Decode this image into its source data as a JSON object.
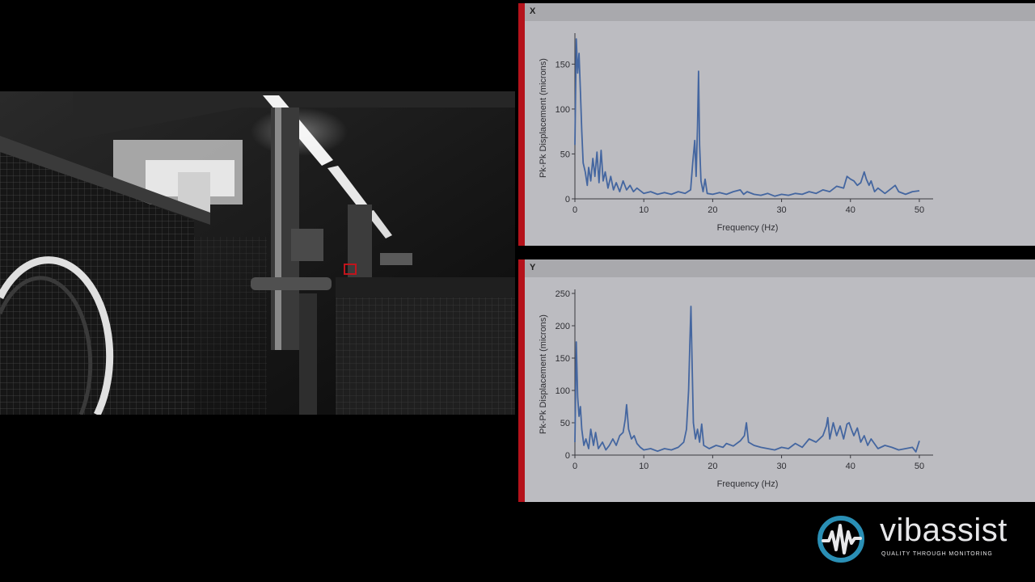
{
  "video": {
    "alt_icon": "factory-camera-feed"
  },
  "brand": {
    "name": "vibassist",
    "tagline": "QUALITY THROUGH MONITORING",
    "accent": "#2a8fb5"
  },
  "colors": {
    "series": "#4466a0",
    "panel_bg": "#bcbcc1",
    "header_bg": "#a9a9ad",
    "red_bar": "#b5121b"
  },
  "chart_data": [
    {
      "type": "line",
      "panel_title": "X",
      "xlabel": "Frequency (Hz)",
      "ylabel": "Pk-Pk Displacement (microns)",
      "xlim": [
        0,
        52
      ],
      "ylim": [
        0,
        180
      ],
      "xticks": [
        0,
        10,
        20,
        30,
        40,
        50
      ],
      "yticks": [
        0,
        50,
        100,
        150
      ],
      "grid": false,
      "series": [
        {
          "values": [
            [
              0,
              60
            ],
            [
              0.2,
              178
            ],
            [
              0.4,
              140
            ],
            [
              0.6,
              162
            ],
            [
              0.8,
              120
            ],
            [
              1.0,
              75
            ],
            [
              1.2,
              40
            ],
            [
              1.5,
              30
            ],
            [
              1.8,
              15
            ],
            [
              2.0,
              35
            ],
            [
              2.3,
              20
            ],
            [
              2.6,
              45
            ],
            [
              2.9,
              25
            ],
            [
              3.2,
              52
            ],
            [
              3.5,
              18
            ],
            [
              3.8,
              54
            ],
            [
              4.1,
              20
            ],
            [
              4.4,
              30
            ],
            [
              4.8,
              12
            ],
            [
              5.2,
              25
            ],
            [
              5.6,
              10
            ],
            [
              6.0,
              18
            ],
            [
              6.5,
              8
            ],
            [
              7.0,
              20
            ],
            [
              7.5,
              10
            ],
            [
              8.0,
              15
            ],
            [
              8.5,
              8
            ],
            [
              9.0,
              12
            ],
            [
              10,
              6
            ],
            [
              11,
              8
            ],
            [
              12,
              5
            ],
            [
              13,
              7
            ],
            [
              14,
              5
            ],
            [
              15,
              8
            ],
            [
              16,
              6
            ],
            [
              16.8,
              10
            ],
            [
              17.1,
              40
            ],
            [
              17.4,
              65
            ],
            [
              17.6,
              25
            ],
            [
              17.8,
              80
            ],
            [
              17.95,
              142
            ],
            [
              18.1,
              60
            ],
            [
              18.3,
              20
            ],
            [
              18.6,
              8
            ],
            [
              18.9,
              22
            ],
            [
              19.2,
              6
            ],
            [
              20,
              5
            ],
            [
              21,
              7
            ],
            [
              22,
              5
            ],
            [
              23,
              8
            ],
            [
              24,
              10
            ],
            [
              24.5,
              5
            ],
            [
              25,
              8
            ],
            [
              26,
              5
            ],
            [
              27,
              4
            ],
            [
              28,
              6
            ],
            [
              29,
              3
            ],
            [
              30,
              5
            ],
            [
              31,
              4
            ],
            [
              32,
              6
            ],
            [
              33,
              5
            ],
            [
              34,
              8
            ],
            [
              35,
              6
            ],
            [
              36,
              10
            ],
            [
              37,
              8
            ],
            [
              38,
              14
            ],
            [
              39,
              12
            ],
            [
              39.5,
              25
            ],
            [
              40,
              22
            ],
            [
              40.5,
              20
            ],
            [
              41,
              15
            ],
            [
              41.5,
              18
            ],
            [
              42,
              30
            ],
            [
              42.3,
              22
            ],
            [
              42.7,
              15
            ],
            [
              43,
              20
            ],
            [
              43.5,
              8
            ],
            [
              44,
              12
            ],
            [
              45,
              6
            ],
            [
              46,
              12
            ],
            [
              46.5,
              15
            ],
            [
              47,
              8
            ],
            [
              48,
              5
            ],
            [
              49,
              8
            ],
            [
              50,
              9
            ]
          ]
        }
      ]
    },
    {
      "type": "line",
      "panel_title": "Y",
      "xlabel": "Frequency (Hz)",
      "ylabel": "Pk-Pk Displacement (microns)",
      "xlim": [
        0,
        52
      ],
      "ylim": [
        0,
        250
      ],
      "xticks": [
        0,
        10,
        20,
        30,
        40,
        50
      ],
      "yticks": [
        0,
        50,
        100,
        150,
        200,
        250
      ],
      "grid": false,
      "series": [
        {
          "values": [
            [
              0,
              20
            ],
            [
              0.2,
              175
            ],
            [
              0.4,
              90
            ],
            [
              0.6,
              60
            ],
            [
              0.8,
              75
            ],
            [
              1.0,
              40
            ],
            [
              1.3,
              15
            ],
            [
              1.6,
              25
            ],
            [
              2.0,
              10
            ],
            [
              2.3,
              40
            ],
            [
              2.7,
              15
            ],
            [
              3.0,
              35
            ],
            [
              3.4,
              10
            ],
            [
              4.0,
              20
            ],
            [
              4.5,
              8
            ],
            [
              5.0,
              15
            ],
            [
              5.5,
              25
            ],
            [
              6.0,
              15
            ],
            [
              6.5,
              30
            ],
            [
              7.0,
              35
            ],
            [
              7.3,
              55
            ],
            [
              7.5,
              78
            ],
            [
              7.8,
              40
            ],
            [
              8.2,
              25
            ],
            [
              8.6,
              30
            ],
            [
              9.0,
              18
            ],
            [
              9.5,
              12
            ],
            [
              10,
              8
            ],
            [
              11,
              10
            ],
            [
              12,
              6
            ],
            [
              13,
              10
            ],
            [
              14,
              8
            ],
            [
              15,
              12
            ],
            [
              15.8,
              20
            ],
            [
              16.2,
              40
            ],
            [
              16.5,
              100
            ],
            [
              16.7,
              180
            ],
            [
              16.85,
              230
            ],
            [
              17.0,
              150
            ],
            [
              17.2,
              50
            ],
            [
              17.5,
              25
            ],
            [
              17.8,
              40
            ],
            [
              18.1,
              20
            ],
            [
              18.4,
              48
            ],
            [
              18.7,
              15
            ],
            [
              19.5,
              10
            ],
            [
              20.5,
              15
            ],
            [
              21.5,
              12
            ],
            [
              22,
              18
            ],
            [
              23,
              14
            ],
            [
              24,
              22
            ],
            [
              24.6,
              30
            ],
            [
              24.9,
              50
            ],
            [
              25.2,
              20
            ],
            [
              26,
              15
            ],
            [
              27,
              12
            ],
            [
              28,
              10
            ],
            [
              29,
              8
            ],
            [
              30,
              12
            ],
            [
              31,
              10
            ],
            [
              32,
              18
            ],
            [
              33,
              12
            ],
            [
              34,
              25
            ],
            [
              35,
              20
            ],
            [
              36,
              30
            ],
            [
              36.5,
              45
            ],
            [
              36.7,
              58
            ],
            [
              37,
              25
            ],
            [
              37.5,
              50
            ],
            [
              38,
              30
            ],
            [
              38.5,
              45
            ],
            [
              39,
              25
            ],
            [
              39.5,
              48
            ],
            [
              39.8,
              50
            ],
            [
              40.2,
              38
            ],
            [
              40.5,
              30
            ],
            [
              41,
              42
            ],
            [
              41.5,
              20
            ],
            [
              42,
              30
            ],
            [
              42.5,
              15
            ],
            [
              43,
              25
            ],
            [
              44,
              10
            ],
            [
              45,
              15
            ],
            [
              46,
              12
            ],
            [
              47,
              8
            ],
            [
              48,
              10
            ],
            [
              49,
              12
            ],
            [
              49.5,
              5
            ],
            [
              50,
              22
            ]
          ]
        }
      ]
    }
  ]
}
